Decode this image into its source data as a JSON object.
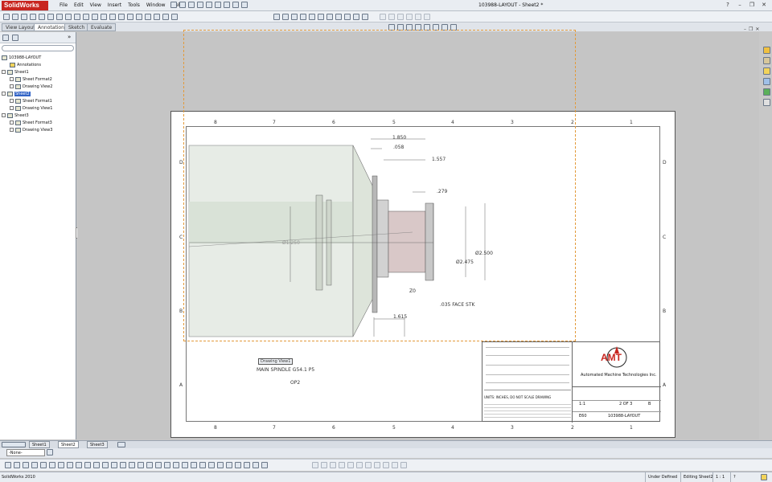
{
  "app": {
    "brand": "SolidWorks",
    "document_title": "103988-LAYOUT - Sheet2 *"
  },
  "menu": [
    "File",
    "Edit",
    "View",
    "Insert",
    "Tools",
    "Window",
    "Help"
  ],
  "command_tabs": [
    {
      "label": "View Layout",
      "active": false
    },
    {
      "label": "Annotation",
      "active": true
    },
    {
      "label": "Sketch",
      "active": false
    },
    {
      "label": "Evaluate",
      "active": false
    }
  ],
  "feature_tree": {
    "root": "103988-LAYOUT",
    "nodes": [
      {
        "label": "Annotations",
        "level": 1,
        "expander": false,
        "selected": false
      },
      {
        "label": "Sheet1",
        "level": 0,
        "expander": true,
        "selected": false
      },
      {
        "label": "Sheet Format2",
        "level": 1,
        "expander": true,
        "selected": false
      },
      {
        "label": "Drawing View2",
        "level": 1,
        "expander": true,
        "selected": false
      },
      {
        "label": "Sheet2",
        "level": 0,
        "expander": true,
        "selected": true
      },
      {
        "label": "Sheet Format1",
        "level": 1,
        "expander": true,
        "selected": false
      },
      {
        "label": "Drawing View1",
        "level": 1,
        "expander": true,
        "selected": false
      },
      {
        "label": "Sheet3",
        "level": 0,
        "expander": true,
        "selected": false
      },
      {
        "label": "Sheet Format3",
        "level": 1,
        "expander": true,
        "selected": false
      },
      {
        "label": "Drawing View3",
        "level": 1,
        "expander": true,
        "selected": false
      }
    ]
  },
  "drawing": {
    "zone_columns": [
      "8",
      "7",
      "6",
      "5",
      "4",
      "3",
      "2",
      "1"
    ],
    "zone_rows": [
      "D",
      "C",
      "B",
      "A"
    ],
    "dimensions": {
      "d1": "1.850",
      "d2": ".058",
      "d3": "1.557",
      "d4": ".279",
      "d5": "Ø2.500",
      "d6": "Ø2.475",
      "d7": "Ø1.250",
      "d8": "Z0",
      "d9": ".035 FACE STK",
      "d10": "1.615"
    },
    "view_label": "Drawing View1",
    "note_line1": "MAIN SPINDLE G54.1 P5",
    "note_line2": "OP2"
  },
  "title_block": {
    "company": "Automated Machine Technologies Inc.",
    "units_note": "UNITS: INCHES, DO NOT SCALE DRAWING",
    "scale": "1:1",
    "sheet": "2 OF 3",
    "rev": "B",
    "size": "B",
    "drawing_number": "103988-LAYOUT",
    "qty": "E60"
  },
  "sheet_tabs": [
    {
      "label": "Sheet1",
      "active": false
    },
    {
      "label": "Sheet2",
      "active": true
    },
    {
      "label": "Sheet3",
      "active": false
    }
  ],
  "layer": {
    "value": "-None-"
  },
  "status": {
    "left": "SolidWorks 2010",
    "definition": "Under Defined",
    "editing": "Editing Sheet2",
    "scale": "1 : 1",
    "help": "?"
  }
}
